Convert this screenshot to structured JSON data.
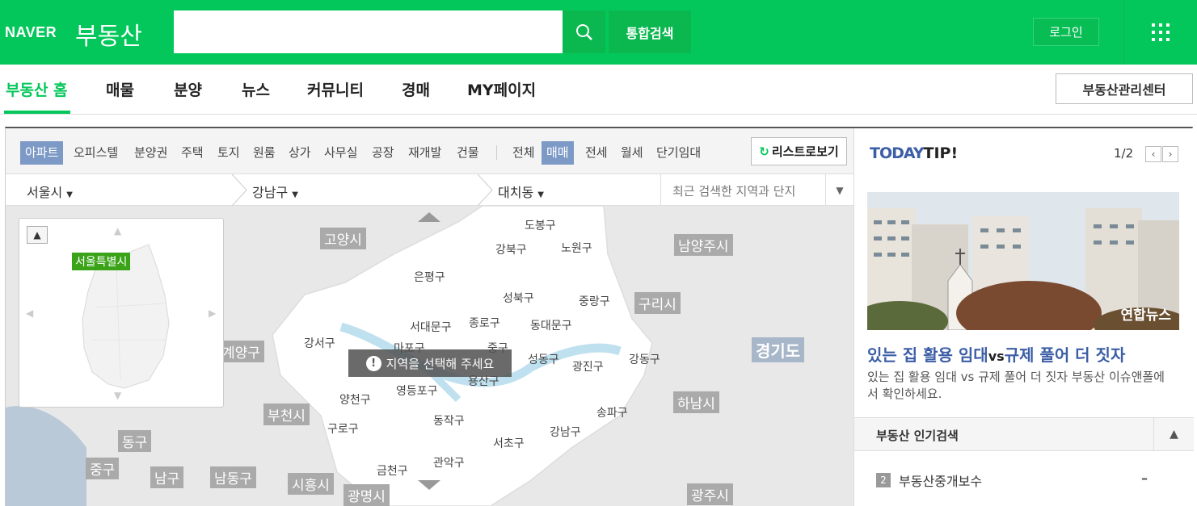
{
  "header": {
    "logo_naver": "NAVER",
    "logo_service": "부동산",
    "search_placeholder": "",
    "total_search_label": "통합검색",
    "login_label": "로그인",
    "brand_color": "#03c75a"
  },
  "nav": {
    "items": [
      {
        "label": "부동산 홈",
        "active": true
      },
      {
        "label": "매물"
      },
      {
        "label": "분양"
      },
      {
        "label": "뉴스"
      },
      {
        "label": "커뮤니티"
      },
      {
        "label": "경매"
      },
      {
        "label": "MY페이지"
      }
    ],
    "mgmt_label": "부동산관리센터"
  },
  "filters": {
    "property_types": [
      "아파트",
      "오피스텔",
      "분양권",
      "주택",
      "토지",
      "원룸",
      "상가",
      "사무실",
      "공장",
      "재개발",
      "건물"
    ],
    "selected_type": "아파트",
    "deal_types": [
      "전체",
      "매매",
      "전세",
      "월세",
      "단기임대"
    ],
    "selected_deal": "매매",
    "list_view_label": "리스트로보기"
  },
  "location": {
    "city": "서울시",
    "district": "강남구",
    "dong": "대치동",
    "recent_label": "최근 검색한 지역과 단지"
  },
  "map": {
    "notice": "지역을 선택해 주세요",
    "minimap_badge": "서울특별시",
    "outer_labels": [
      "고양시",
      "남양주시",
      "구리시",
      "경기도",
      "계양구",
      "부천시",
      "하남시",
      "동구",
      "중구",
      "남구",
      "남동구",
      "시흥시",
      "광명시",
      "광주시"
    ],
    "districts": [
      "도봉구",
      "강북구",
      "노원구",
      "은평구",
      "성북구",
      "중랑구",
      "서대문구",
      "종로구",
      "동대문구",
      "강서구",
      "마포구",
      "중구",
      "성동구",
      "광진구",
      "강동구",
      "양천구",
      "영등포구",
      "용산구",
      "구로구",
      "동작구",
      "송파구",
      "서초구",
      "강남구",
      "금천구",
      "관악구"
    ]
  },
  "tip": {
    "today": "TODAY",
    "tip": "TIP!",
    "pager": "1/2",
    "photo_caption": "연합뉴스",
    "title_part1": "있는 집 활용 임대",
    "title_vs": "vs",
    "title_part2": "규제 풀어 더 짓자",
    "description": "있는 집 활용 임대 vs 규제 풀어 더 짓자 부동산 이슈앤폴에서 확인하세요."
  },
  "popular": {
    "title": "부동산 인기검색",
    "items": [
      {
        "rank": "2",
        "keyword": "부동산중개보수",
        "change": "–"
      }
    ]
  }
}
